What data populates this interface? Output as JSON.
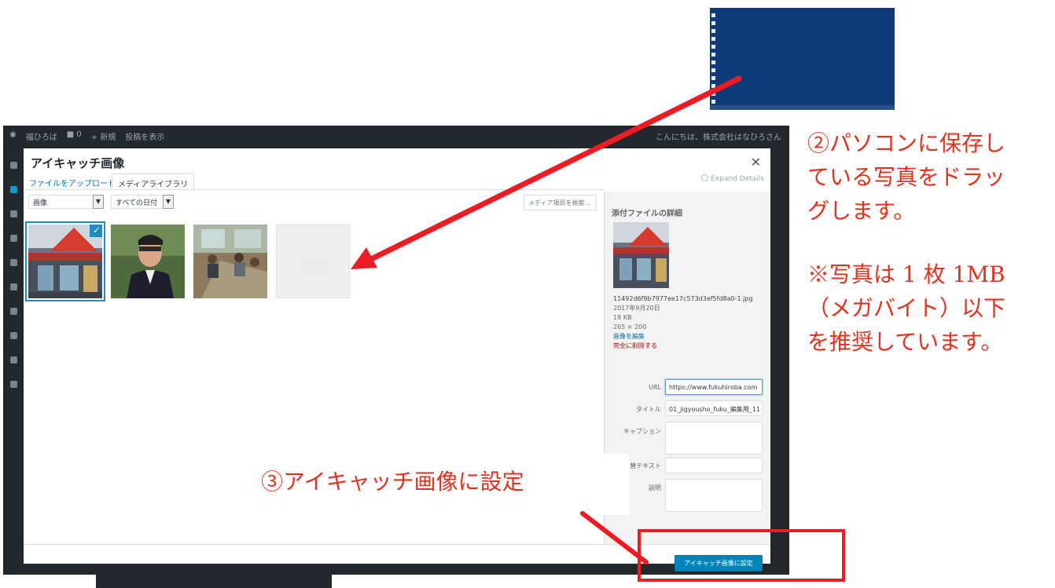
{
  "admin_bar": {
    "left_items": [
      "福ひろば",
      "■ 0",
      "+ 新規",
      "投稿を表示"
    ],
    "greeting": "こんにちは、株式会社はなひろさん"
  },
  "modal": {
    "title": "アイキャッチ画像",
    "tabs": [
      "ファイルをアップロード",
      "メディアライブラリ"
    ],
    "active_tab": 1,
    "expand_details": "Expand Details",
    "filter_type": "画像",
    "filter_date": "すべての日付",
    "search_placeholder": "メディア項目を検索...",
    "primary_button": "アイキャッチ画像に設定"
  },
  "attachment": {
    "heading": "添付ファイルの詳細",
    "filename": "11492d6f9b7977ee17c573d3ef5fd8a0-1.jpg",
    "date": "2017年9月20日",
    "size": "18 KB",
    "dimensions": "265 × 200",
    "edit_link": "画像を編集",
    "delete_link": "完全に削除する",
    "labels": {
      "url": "URL",
      "title": "タイトル",
      "caption": "キャプション",
      "alt": "替テキスト",
      "description": "説明"
    },
    "values": {
      "url": "https://www.fukuhiroba.com",
      "title": "01_jigyousho_fuku_編集用_11"
    }
  },
  "annotations": {
    "drag_line1": "②パソコンに保存し",
    "drag_line2": "ている写真をドラッ",
    "drag_line3": "グします。",
    "note_line1": "※写真は 1 枚 1MB",
    "note_line2": "（メガバイト）以下",
    "note_line3": "を推奨しています。",
    "set_featured": "③アイキャッチ画像に設定"
  },
  "colors": {
    "annotation_red": "#e3311d",
    "wp_primary": "#0085ba",
    "desktop_blue": "#0d3a78"
  },
  "icons": [
    "wordpress-icon",
    "close-icon",
    "check-icon",
    "chevron-down-icon"
  ]
}
